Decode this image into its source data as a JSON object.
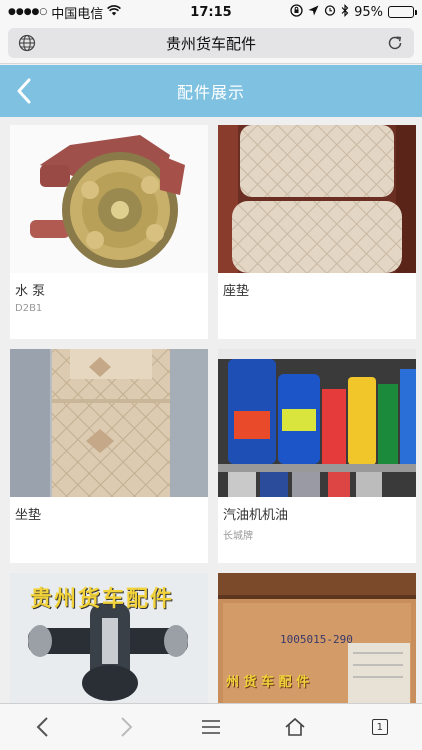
{
  "status_bar": {
    "signal": "●●●●○",
    "carrier": "中国电信",
    "time": "17:15",
    "battery": "95%",
    "battery_level": 0.95
  },
  "browser": {
    "title": "贵州货车配件",
    "tab_count": "1"
  },
  "header": {
    "title": "配件展示"
  },
  "products": [
    {
      "title": "水 泵",
      "subtitle": "D2B1",
      "image": "water-pump"
    },
    {
      "title": "座垫",
      "subtitle": "",
      "image": "seat-cushion"
    },
    {
      "title": "坐垫",
      "subtitle": "",
      "image": "seat-cover"
    },
    {
      "title": "汽油机机油",
      "subtitle": "长城牌",
      "image": "engine-oil"
    },
    {
      "title": "",
      "subtitle": "",
      "image": "universal-joint",
      "watermark": "贵州货车配件"
    },
    {
      "title": "",
      "subtitle": "",
      "image": "parts-box",
      "box_code": "1005015-290",
      "watermark": "州 货 车 配 件"
    }
  ],
  "colors": {
    "header_bg": "#7fc1e0",
    "page_bg": "#efefef"
  }
}
